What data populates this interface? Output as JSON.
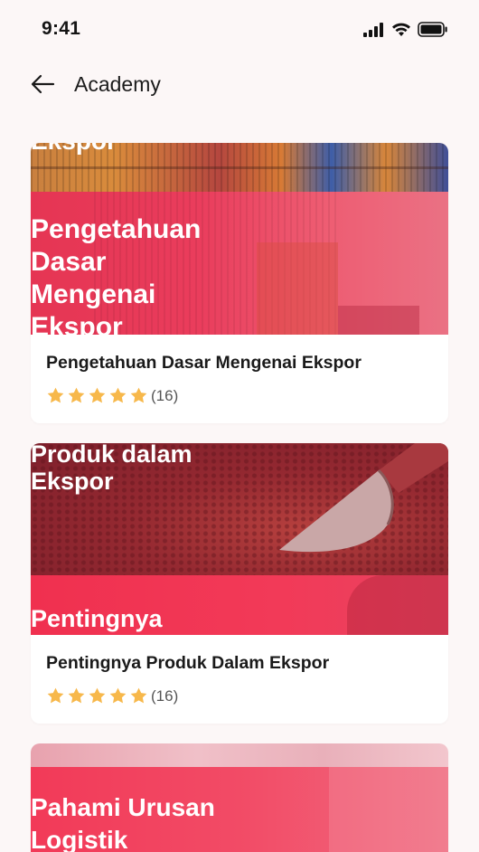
{
  "status": {
    "time": "9:41"
  },
  "header": {
    "title": "Academy"
  },
  "courses": [
    {
      "thumb_top_text": "Ekspor",
      "thumb_text": [
        "Pengetahuan",
        "Dasar",
        "Mengenai",
        "Ekspor"
      ],
      "title": "Pengetahuan Dasar Mengenai Ekspor",
      "rating_count": "(16)"
    },
    {
      "thumb_top_text": [
        "Produk dalam",
        "Ekspor"
      ],
      "thumb_text": [
        "Pentingnya"
      ],
      "title": "Pentingnya Produk Dalam Ekspor",
      "rating_count": "(16)"
    },
    {
      "thumb_text": [
        "Pahami Urusan",
        "Logistik"
      ]
    }
  ],
  "colors": {
    "accent": "#f0284a",
    "star": "#f7b84b"
  }
}
